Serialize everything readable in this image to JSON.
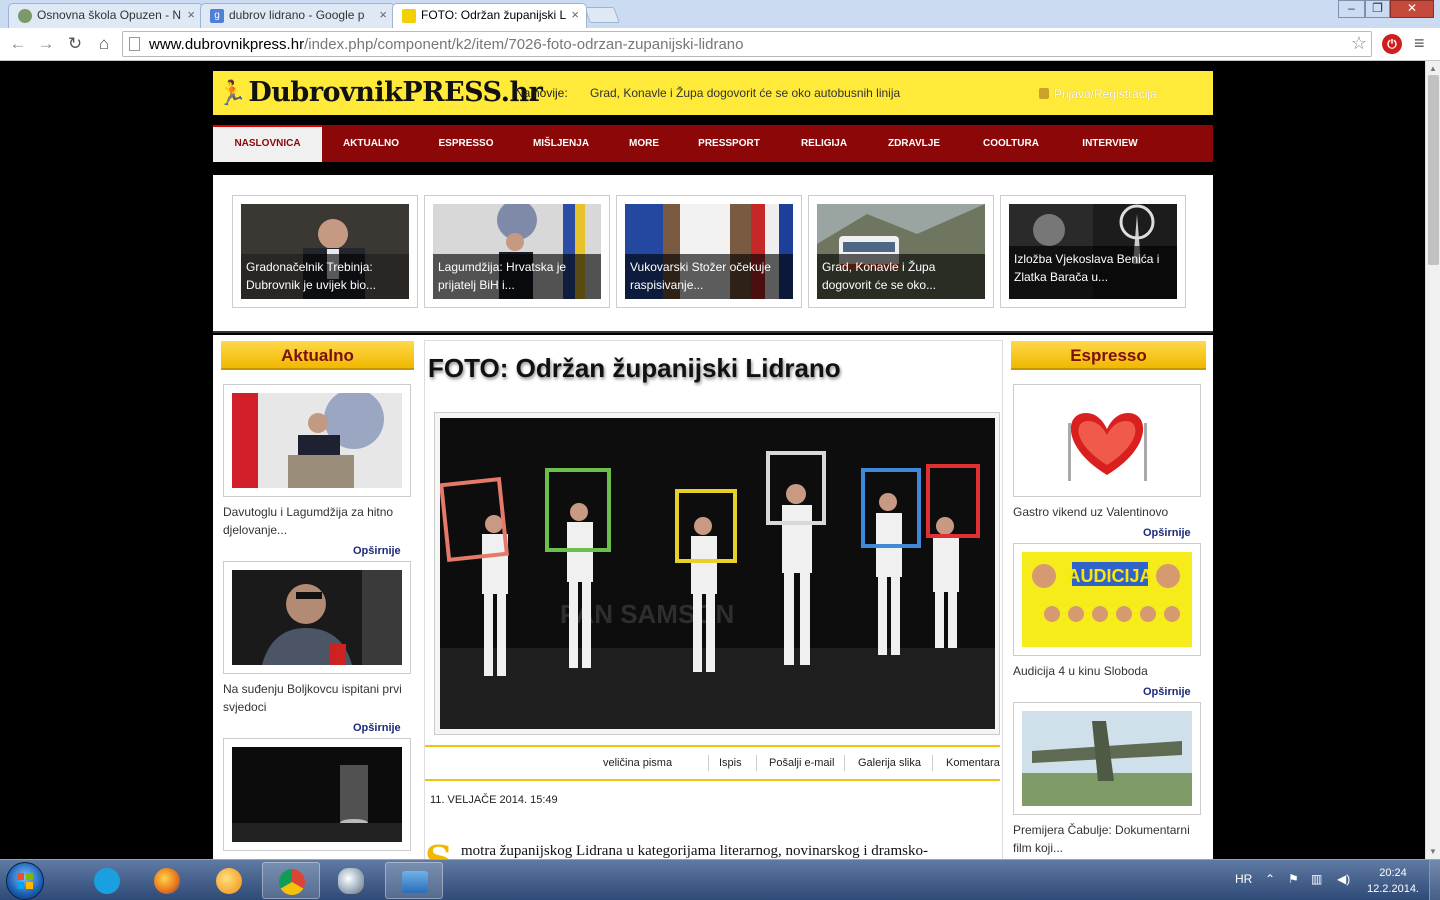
{
  "browser": {
    "tabs": [
      {
        "label": "Osnovna škola Opuzen - N",
        "favicon_color": "#7a9a6a"
      },
      {
        "label": "dubrov lidrano - Google p",
        "favicon_color": "#4f7fd8"
      },
      {
        "label": "FOTO: Održan županijski L",
        "favicon_color": "#f3d000"
      }
    ],
    "url_host": "www.dubrovnikpress.hr",
    "url_path": "/index.php/component/k2/item/7026-foto-odrzan-zupanijski-lidrano"
  },
  "header": {
    "logo": "DubrovnikPRESS.hr",
    "najnovije_label": "Najnovije:",
    "ticker": "Grad, Konavle i Župa dogovorit će se oko autobusnih linija",
    "login": "Prijava/Registracija"
  },
  "nav": [
    "NASLOVNICA",
    "AKTUALNO",
    "ESPRESSO",
    "MIŠLJENJA",
    "MORE",
    "PRESSPORT",
    "RELIGIJA",
    "ZDRAVLJE",
    "COOLTURA",
    "INTERVIEW"
  ],
  "featured": [
    {
      "line1": "Gradonačelnik Trebinja:",
      "line2": "Dubrovnik je uvijek bio..."
    },
    {
      "line1": "Lagumdžija: Hrvatska je",
      "line2": "prijatelj BiH i..."
    },
    {
      "line1": "Vukovarski Stožer očekuje",
      "line2": "raspisivanje..."
    },
    {
      "line1": "Grad, Konavle i Župa",
      "line2": "dogovorit će se oko..."
    },
    {
      "line1": "Izložba Vjekoslava Benića i",
      "line2": "Zlatka Barača u..."
    }
  ],
  "left": {
    "heading": "Aktualno",
    "items": [
      {
        "line1": "Davutoglu i Lagumdžija za hitno",
        "line2": "djelovanje...",
        "more": "Opširnije"
      },
      {
        "line1": "Na suđenju Boljkovcu ispitani prvi",
        "line2": "svjedoci",
        "more": "Opširnije"
      }
    ]
  },
  "article": {
    "title": "FOTO: Održan županijski Lidrano",
    "tools": [
      "veličina pisma",
      "Ispis",
      "Pošalji e-mail",
      "Galerija slika",
      "Komentara"
    ],
    "date": "11. VELJAČE 2014. 15:49",
    "dropcap": "S",
    "lead": "motra županijskog Lidrana u kategorijama literarnog, novinarskog i dramsko-"
  },
  "right": {
    "heading": "Espresso",
    "items": [
      {
        "line1": "Gastro vikend uz Valentinovo",
        "line2": "",
        "more": "Opširnije"
      },
      {
        "line1": "Audicija 4 u kinu Sloboda",
        "line2": "",
        "more": "Opširnije"
      },
      {
        "line1": "Premijera Čabulje: Dokumentarni",
        "line2": "film koji...",
        "more": ""
      }
    ]
  },
  "taskbar": {
    "lang": "HR",
    "time": "20:24",
    "date": "12.2.2014."
  }
}
